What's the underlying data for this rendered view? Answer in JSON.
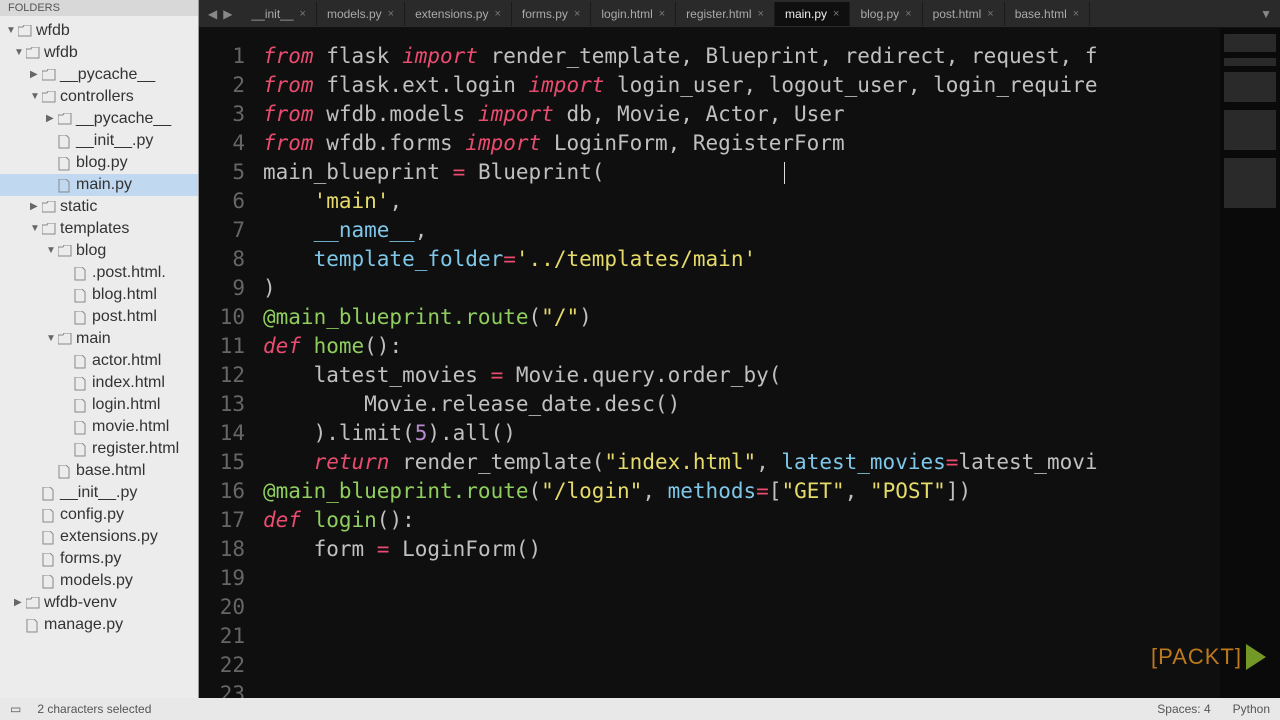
{
  "sidebar": {
    "header": "FOLDERS",
    "tree": [
      {
        "depth": 0,
        "type": "folder",
        "name": "wfdb",
        "caret": "▼"
      },
      {
        "depth": 1,
        "type": "folder",
        "name": "wfdb",
        "caret": "▼"
      },
      {
        "depth": 2,
        "type": "folder",
        "name": "__pycache__",
        "caret": "▶"
      },
      {
        "depth": 2,
        "type": "folder",
        "name": "controllers",
        "caret": "▼"
      },
      {
        "depth": 3,
        "type": "folder",
        "name": "__pycache__",
        "caret": "▶"
      },
      {
        "depth": 3,
        "type": "file",
        "name": "__init__.py"
      },
      {
        "depth": 3,
        "type": "file",
        "name": "blog.py"
      },
      {
        "depth": 3,
        "type": "file",
        "name": "main.py",
        "selected": true
      },
      {
        "depth": 2,
        "type": "folder",
        "name": "static",
        "caret": "▶"
      },
      {
        "depth": 2,
        "type": "folder",
        "name": "templates",
        "caret": "▼"
      },
      {
        "depth": 3,
        "type": "folder",
        "name": "blog",
        "caret": "▼"
      },
      {
        "depth": 4,
        "type": "file",
        "name": ".post.html."
      },
      {
        "depth": 4,
        "type": "file",
        "name": "blog.html"
      },
      {
        "depth": 4,
        "type": "file",
        "name": "post.html"
      },
      {
        "depth": 3,
        "type": "folder",
        "name": "main",
        "caret": "▼"
      },
      {
        "depth": 4,
        "type": "file",
        "name": "actor.html"
      },
      {
        "depth": 4,
        "type": "file",
        "name": "index.html"
      },
      {
        "depth": 4,
        "type": "file",
        "name": "login.html"
      },
      {
        "depth": 4,
        "type": "file",
        "name": "movie.html"
      },
      {
        "depth": 4,
        "type": "file",
        "name": "register.html"
      },
      {
        "depth": 3,
        "type": "file",
        "name": "base.html"
      },
      {
        "depth": 2,
        "type": "file",
        "name": "__init__.py"
      },
      {
        "depth": 2,
        "type": "file",
        "name": "config.py"
      },
      {
        "depth": 2,
        "type": "file",
        "name": "extensions.py"
      },
      {
        "depth": 2,
        "type": "file",
        "name": "forms.py"
      },
      {
        "depth": 2,
        "type": "file",
        "name": "models.py"
      },
      {
        "depth": 1,
        "type": "folder",
        "name": "wfdb-venv",
        "caret": "▶"
      },
      {
        "depth": 1,
        "type": "file",
        "name": "manage.py"
      }
    ]
  },
  "tabs": [
    {
      "label": "__init__"
    },
    {
      "label": "models.py"
    },
    {
      "label": "extensions.py"
    },
    {
      "label": "forms.py"
    },
    {
      "label": "login.html"
    },
    {
      "label": "register.html"
    },
    {
      "label": "main.py",
      "active": true
    },
    {
      "label": "blog.py"
    },
    {
      "label": "post.html"
    },
    {
      "label": "base.html"
    }
  ],
  "code_lines": [
    [
      {
        "t": "from ",
        "c": "kw"
      },
      {
        "t": "flask "
      },
      {
        "t": "import ",
        "c": "kw"
      },
      {
        "t": "render_template, Blueprint, redirect, request, f"
      }
    ],
    [
      {
        "t": "from ",
        "c": "kw"
      },
      {
        "t": "flask.ext.login "
      },
      {
        "t": "import ",
        "c": "kw"
      },
      {
        "t": "login_user, logout_user, login_require"
      }
    ],
    [
      {
        "t": ""
      }
    ],
    [
      {
        "t": "from ",
        "c": "kw"
      },
      {
        "t": "wfdb.models "
      },
      {
        "t": "import ",
        "c": "kw"
      },
      {
        "t": "db, Movie, Actor, User"
      }
    ],
    [
      {
        "t": "from ",
        "c": "kw"
      },
      {
        "t": "wfdb.forms "
      },
      {
        "t": "import ",
        "c": "kw"
      },
      {
        "t": "LoginForm, RegisterForm"
      }
    ],
    [
      {
        "t": ""
      }
    ],
    [
      {
        "t": "main_blueprint "
      },
      {
        "t": "= ",
        "c": "kw"
      },
      {
        "t": "Blueprint("
      }
    ],
    [
      {
        "t": "    "
      },
      {
        "t": "'main'",
        "c": "str"
      },
      {
        "t": ","
      }
    ],
    [
      {
        "t": "    "
      },
      {
        "t": "__name__",
        "c": "var"
      },
      {
        "t": ","
      }
    ],
    [
      {
        "t": "    "
      },
      {
        "t": "template_folder",
        "c": "var"
      },
      {
        "t": "=",
        "c": "kw"
      },
      {
        "t": "'../templates/main'",
        "c": "str"
      }
    ],
    [
      {
        "t": ")"
      }
    ],
    [
      {
        "t": ""
      }
    ],
    [
      {
        "t": "@main_blueprint.route",
        "c": "decl"
      },
      {
        "t": "("
      },
      {
        "t": "\"/\"",
        "c": "str"
      },
      {
        "t": ")"
      }
    ],
    [
      {
        "t": "def ",
        "c": "kw"
      },
      {
        "t": "home",
        "c": "decl"
      },
      {
        "t": "():"
      }
    ],
    [
      {
        "t": "    latest_movies "
      },
      {
        "t": "= ",
        "c": "kw"
      },
      {
        "t": "Movie.query.order_by("
      }
    ],
    [
      {
        "t": "        Movie.release_date.desc()"
      }
    ],
    [
      {
        "t": "    ).limit("
      },
      {
        "t": "5",
        "c": "num"
      },
      {
        "t": ").all()"
      }
    ],
    [
      {
        "t": ""
      }
    ],
    [
      {
        "t": "    "
      },
      {
        "t": "return ",
        "c": "kw"
      },
      {
        "t": "render_template("
      },
      {
        "t": "\"index.html\"",
        "c": "str"
      },
      {
        "t": ", "
      },
      {
        "t": "latest_movies",
        "c": "var"
      },
      {
        "t": "=",
        "c": "kw"
      },
      {
        "t": "latest_movi"
      }
    ],
    [
      {
        "t": ""
      }
    ],
    [
      {
        "t": "@main_blueprint.route",
        "c": "decl"
      },
      {
        "t": "("
      },
      {
        "t": "\"/login\"",
        "c": "str"
      },
      {
        "t": ", "
      },
      {
        "t": "methods",
        "c": "var"
      },
      {
        "t": "=",
        "c": "kw"
      },
      {
        "t": "["
      },
      {
        "t": "\"GET\"",
        "c": "str"
      },
      {
        "t": ", "
      },
      {
        "t": "\"POST\"",
        "c": "str"
      },
      {
        "t": "])"
      }
    ],
    [
      {
        "t": "def ",
        "c": "kw"
      },
      {
        "t": "login",
        "c": "decl"
      },
      {
        "t": "():"
      }
    ],
    [
      {
        "t": "    form "
      },
      {
        "t": "= ",
        "c": "kw"
      },
      {
        "t": "LoginForm()"
      }
    ]
  ],
  "statusbar": {
    "left_icon": "▭",
    "selection": "2 characters selected",
    "spaces": "Spaces: 4",
    "syntax": "Python"
  },
  "logo": {
    "text": "[PACKT]"
  }
}
